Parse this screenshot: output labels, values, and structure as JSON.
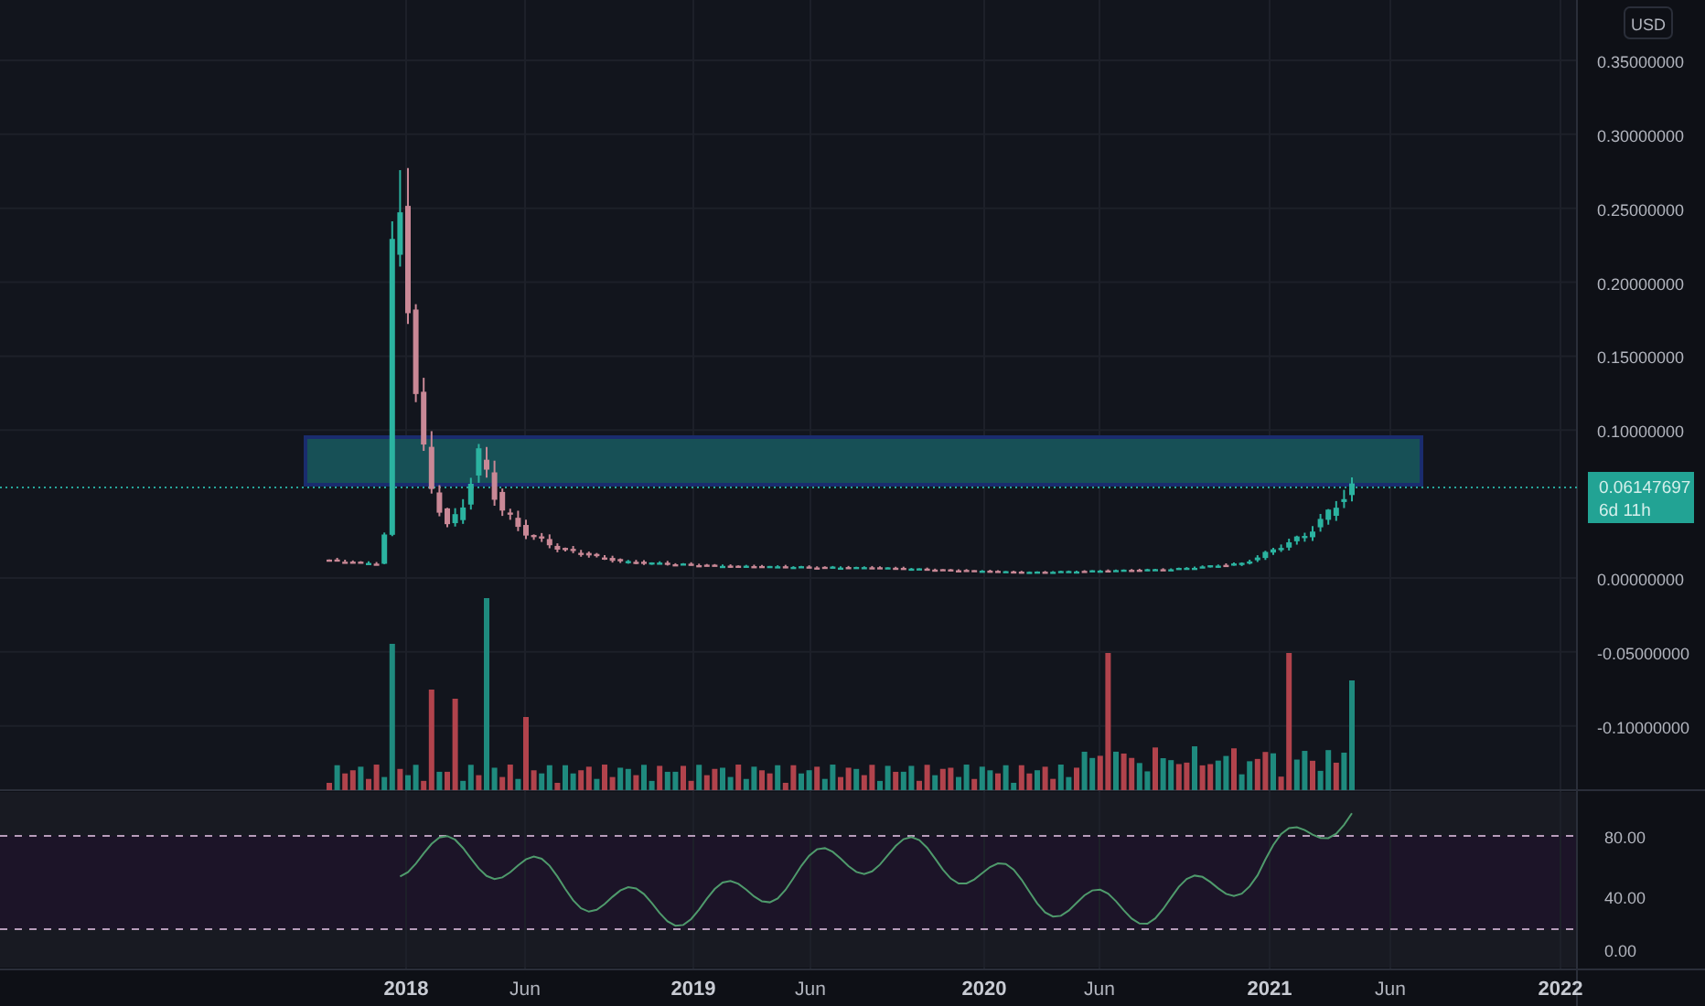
{
  "currency": "USD",
  "price_axis": {
    "ticks": [
      "0.35000000",
      "0.30000000",
      "0.25000000",
      "0.20000000",
      "0.15000000",
      "0.10000000",
      "0.00000000",
      "-0.05000000",
      "-0.10000000"
    ]
  },
  "last_price": {
    "value": "0.06147697",
    "countdown": "6d 11h"
  },
  "rsi_axis": {
    "ticks": [
      "80.00",
      "40.00",
      "0.00"
    ]
  },
  "time_axis": {
    "ticks": [
      {
        "label": "2018",
        "kind": "year"
      },
      {
        "label": "Jun",
        "kind": "month"
      },
      {
        "label": "2019",
        "kind": "year"
      },
      {
        "label": "Jun",
        "kind": "month"
      },
      {
        "label": "2020",
        "kind": "year"
      },
      {
        "label": "Jun",
        "kind": "month"
      },
      {
        "label": "2021",
        "kind": "year"
      },
      {
        "label": "Jun",
        "kind": "month"
      },
      {
        "label": "2022",
        "kind": "year"
      }
    ]
  }
}
